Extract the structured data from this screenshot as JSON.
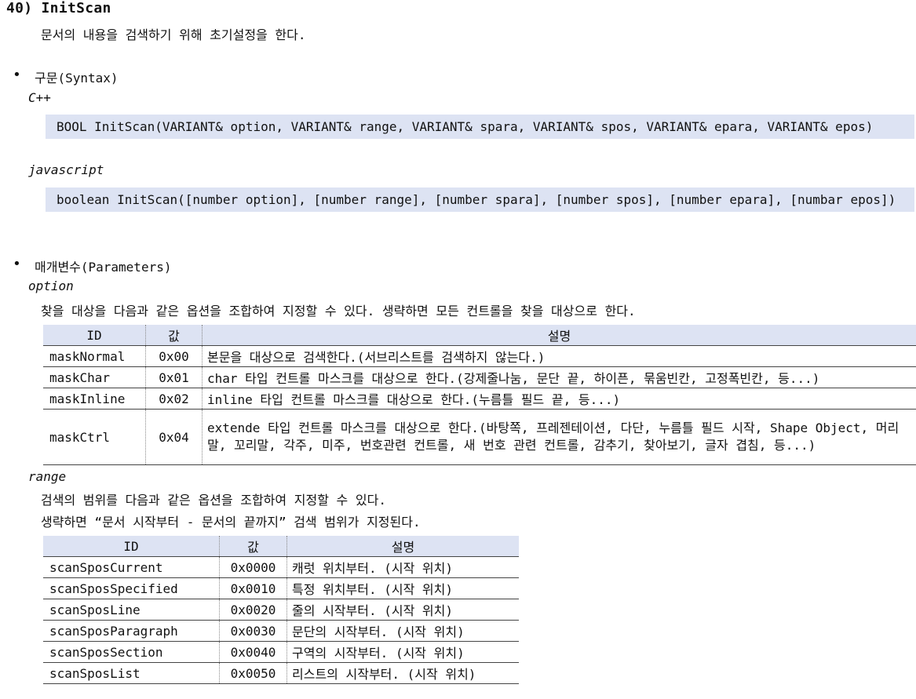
{
  "title": "40) InitScan",
  "description": "문서의 내용을 검색하기 위해 초기설정을 한다.",
  "syntax": {
    "bullet": "•",
    "heading": "구문(Syntax)",
    "cpp_label": "C++",
    "cpp_code": "BOOL InitScan(VARIANT& option, VARIANT& range, VARIANT& spara, VARIANT& spos, VARIANT& epara, VARIANT& epos)",
    "js_label": "javascript",
    "js_code": "boolean InitScan([number option], [number range], [number spara], [number spos], [number epara], [numbar epos])"
  },
  "params": {
    "bullet": "•",
    "heading": "매개변수(Parameters)",
    "option_label": "option",
    "option_desc": "찾을 대상을 다음과 같은 옵션을 조합하여 지정할 수 있다. 생략하면 모든 컨트롤을 찾을 대상으로 한다.",
    "option_table": {
      "headers": [
        "ID",
        "값",
        "설명"
      ],
      "rows": [
        [
          "maskNormal",
          "0x00",
          "본문을 대상으로 검색한다.(서브리스트를 검색하지 않는다.)"
        ],
        [
          "maskChar",
          "0x01",
          "char 타입 컨트롤 마스크를 대상으로 한다.(강제줄나눔, 문단 끝, 하이픈, 묶움빈칸, 고정폭빈칸, 등...)"
        ],
        [
          "maskInline",
          "0x02",
          "inline 타입 컨트롤 마스크를 대상으로 한다.(누름틀 필드 끝, 등...)"
        ],
        [
          "maskCtrl",
          "0x04",
          "extende 타입 컨트롤 마스크를 대상으로 한다.(바탕쪽, 프레젠테이션, 다단, 누름틀 필드 시작, Shape Object, 머리말, 꼬리말, 각주, 미주, 번호관련 컨트롤, 새 번호 관련 컨트롤, 감추기, 찾아보기, 글자 겹침, 등...)"
        ]
      ]
    },
    "range_label": "range",
    "range_desc1": "검색의 범위를 다음과 같은 옵션을 조합하여 지정할 수 있다.",
    "range_desc2": "생략하면 “문서 시작부터 - 문서의 끝까지” 검색 범위가 지정된다.",
    "range_table": {
      "headers": [
        "ID",
        "값",
        "설명"
      ],
      "rows": [
        [
          "scanSposCurrent",
          "0x0000",
          "캐럿 위치부터. (시작 위치)"
        ],
        [
          "scanSposSpecified",
          "0x0010",
          "특정 위치부터. (시작 위치)"
        ],
        [
          "scanSposLine",
          "0x0020",
          "줄의 시작부터. (시작 위치)"
        ],
        [
          "scanSposParagraph",
          "0x0030",
          "문단의 시작부터. (시작 위치)"
        ],
        [
          "scanSposSection",
          "0x0040",
          "구역의 시작부터. (시작 위치)"
        ],
        [
          "scanSposList",
          "0x0050",
          "리스트의 시작부터. (시작 위치)"
        ]
      ]
    }
  }
}
